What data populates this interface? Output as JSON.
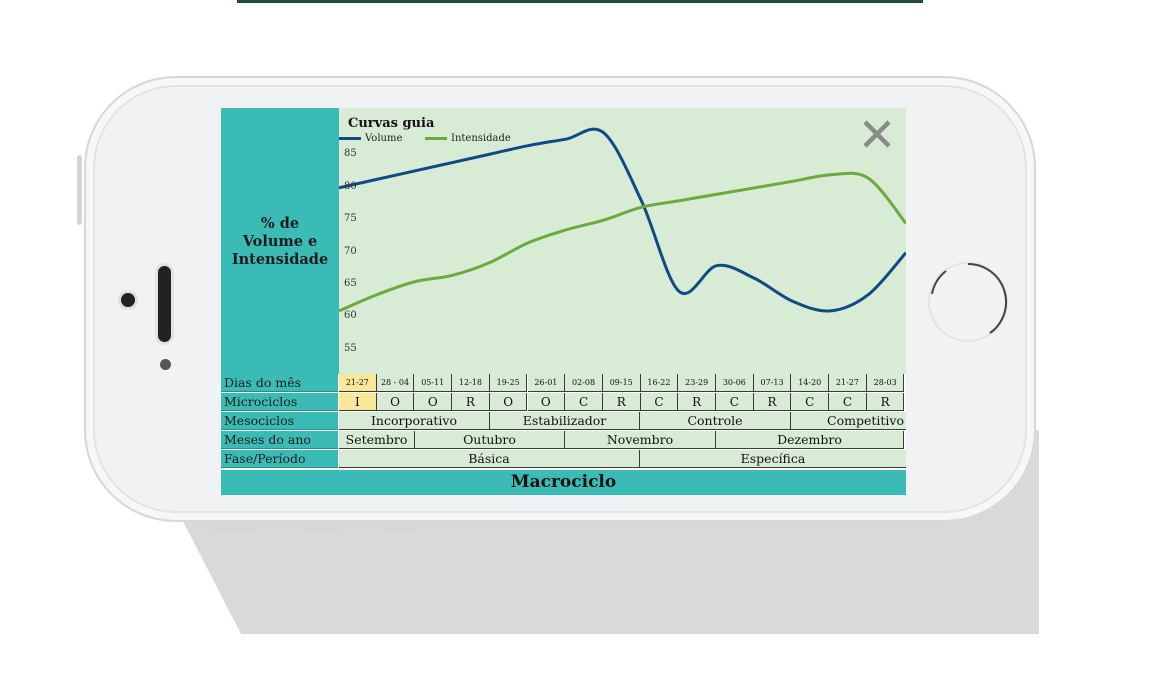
{
  "colors": {
    "accent": "#3bbbb5",
    "chart_bg": "#d8ebd5",
    "volume": "#0f4a86",
    "intensidade": "#6aaa3e",
    "highlight": "#fbe79a"
  },
  "screen": {
    "ylabel": "% de\nVolume e\nIntensidade",
    "close_icon": "close-icon",
    "footer": "Macrociclo"
  },
  "table": {
    "labels": {
      "dias": "Dias do mês",
      "micro": "Microciclos",
      "meso": "Mesociclos",
      "meses": "Meses do ano",
      "fase": "Fase/Período"
    },
    "dias": [
      "21-27",
      "28 - 04",
      "05-11",
      "12-18",
      "19-25",
      "26-01",
      "02-08",
      "09-15",
      "16-22",
      "23-29",
      "30-06",
      "07-13",
      "14-20",
      "21-27",
      "28-03"
    ],
    "micro": [
      "I",
      "O",
      "O",
      "R",
      "O",
      "O",
      "C",
      "R",
      "C",
      "R",
      "C",
      "R",
      "C",
      "C",
      "R"
    ],
    "micro_highlight_index": 0,
    "meso": [
      "Incorporativo",
      "Estabilizador",
      "Controle",
      "Competitivo"
    ],
    "meses": [
      "Setembro",
      "Outubro",
      "Novembro",
      "Dezembro"
    ],
    "fase": [
      "Básica",
      "Específica"
    ]
  },
  "chart_data": {
    "type": "line",
    "title": "Curvas guia",
    "yticks": [
      85,
      80,
      75,
      70,
      65,
      60,
      55
    ],
    "ylim": [
      52.5,
      90
    ],
    "x": [
      0,
      1,
      2,
      3,
      4,
      5,
      6,
      7,
      8,
      9,
      10,
      11,
      12,
      13,
      14,
      15
    ],
    "series": [
      {
        "name": "Volume",
        "values": [
          80,
          81.3,
          82.6,
          83.9,
          85.2,
          86.5,
          87.5,
          88.5,
          78,
          64,
          68,
          66,
          62.5,
          61,
          63.5,
          70
        ]
      },
      {
        "name": "Intensidade",
        "values": [
          61,
          63.5,
          65.5,
          66.5,
          68.5,
          71.5,
          73.5,
          75,
          77,
          78,
          79,
          80,
          81,
          82,
          81.5,
          74.5
        ]
      }
    ]
  }
}
